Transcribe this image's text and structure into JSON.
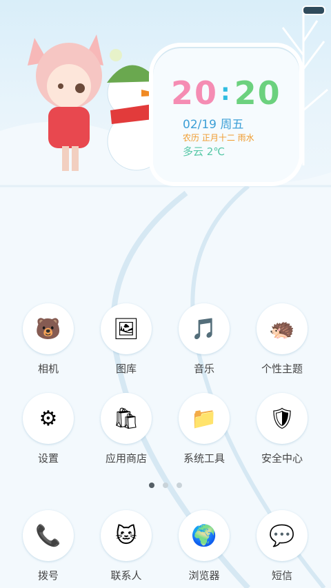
{
  "status_bar": {
    "battery_icon": "battery-icon"
  },
  "widget": {
    "time_hour": "20",
    "time_sep": ":",
    "time_minute": "20",
    "date": "02/19 周五",
    "lunar": "农历 正月十二 雨水",
    "weather": "多云 2℃"
  },
  "apps": [
    {
      "label": "相机",
      "icon": "camera-icon"
    },
    {
      "label": "图库",
      "icon": "gallery-icon"
    },
    {
      "label": "音乐",
      "icon": "music-icon"
    },
    {
      "label": "个性主题",
      "icon": "theme-icon"
    },
    {
      "label": "设置",
      "icon": "settings-icon"
    },
    {
      "label": "应用商店",
      "icon": "app-store-icon"
    },
    {
      "label": "系统工具",
      "icon": "system-tools-icon"
    },
    {
      "label": "安全中心",
      "icon": "security-icon"
    }
  ],
  "dock": [
    {
      "label": "拨号",
      "icon": "phone-icon"
    },
    {
      "label": "联系人",
      "icon": "contacts-icon"
    },
    {
      "label": "浏览器",
      "icon": "browser-icon"
    },
    {
      "label": "短信",
      "icon": "sms-icon"
    }
  ],
  "pager": {
    "pages": 3,
    "current": 1
  },
  "colors": {
    "hour": "#f58cb3",
    "minute": "#6cd17e",
    "date": "#3c9fd6",
    "lunar": "#f09a2b",
    "weather": "#55c7a6"
  }
}
